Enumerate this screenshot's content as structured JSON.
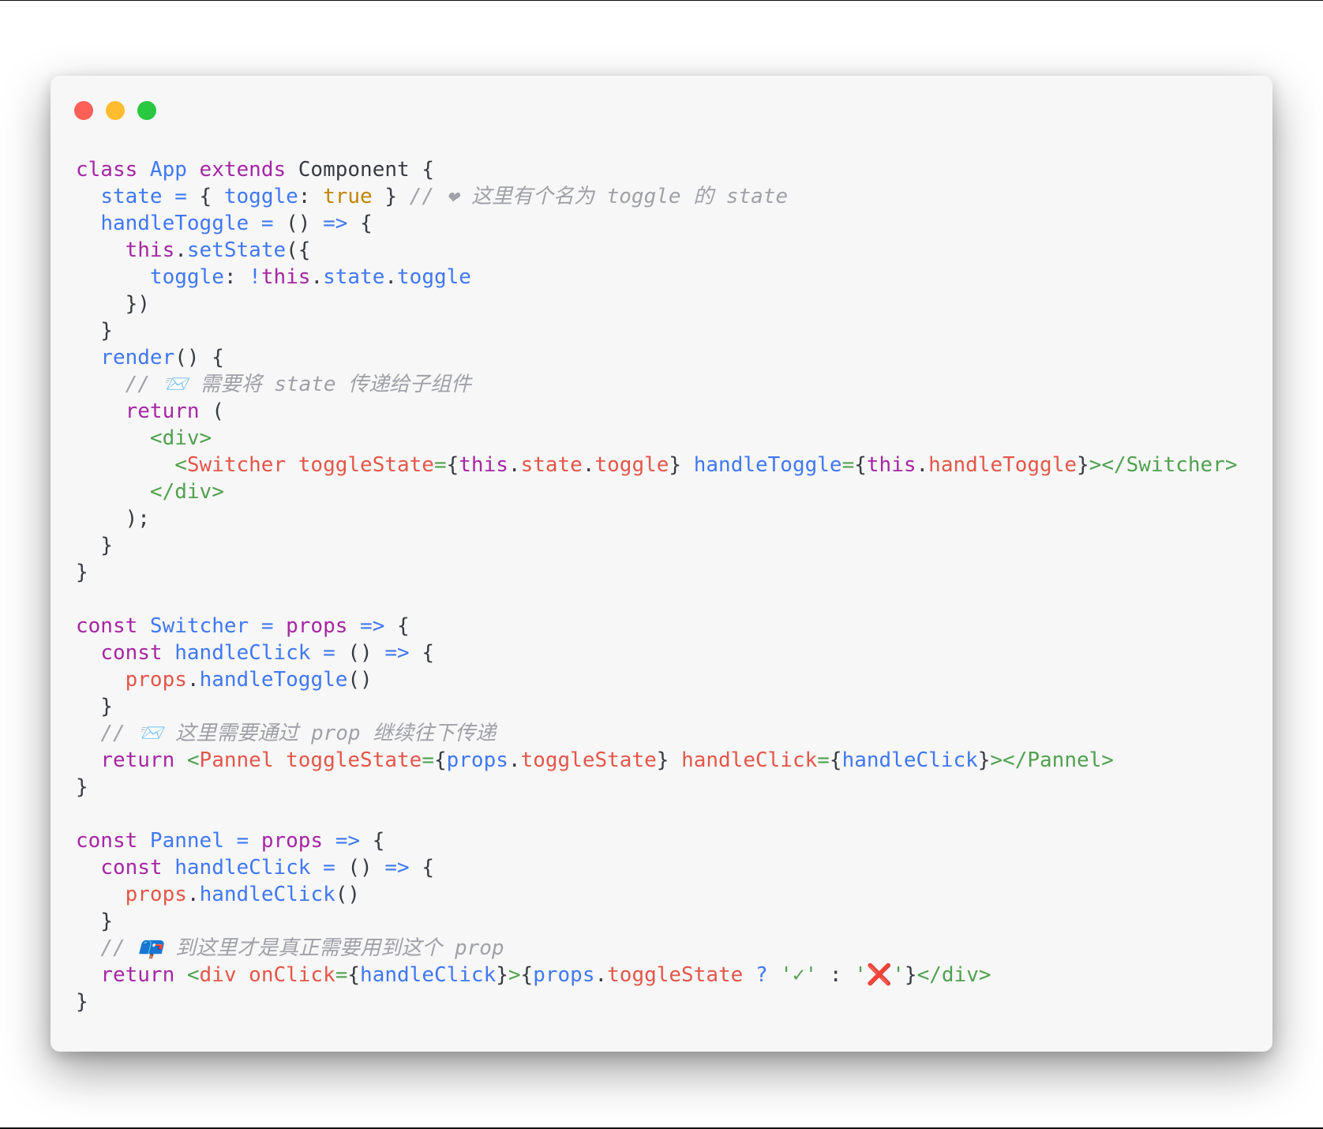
{
  "window": {
    "traffic_lights": [
      {
        "name": "close",
        "color": "#fe5f57"
      },
      {
        "name": "minimize",
        "color": "#febc2e"
      },
      {
        "name": "maximize",
        "color": "#28c840"
      }
    ]
  },
  "colors": {
    "keyword": "#a626a4",
    "function": "#4078f2",
    "boolean": "#c18401",
    "comment": "#a0a1a7",
    "tag": "#50a14f",
    "attribute": "#e45649",
    "punctuation": "#383a42"
  },
  "code": {
    "lines": [
      [
        [
          "k",
          "class "
        ],
        [
          "fn",
          "App "
        ],
        [
          "k",
          "extends "
        ],
        [
          "p",
          "Component {"
        ]
      ],
      [
        [
          "p",
          "  "
        ],
        [
          "fn",
          "state "
        ],
        [
          "fn",
          "= "
        ],
        [
          "p",
          "{ "
        ],
        [
          "fn",
          "toggle"
        ],
        [
          "p",
          ": "
        ],
        [
          "bool",
          "true "
        ],
        [
          "p",
          "} "
        ],
        [
          "c",
          "// ❤ 这里有个名为 toggle 的 state"
        ]
      ],
      [
        [
          "p",
          "  "
        ],
        [
          "fn",
          "handleToggle "
        ],
        [
          "fn",
          "= "
        ],
        [
          "p",
          "() "
        ],
        [
          "fn",
          "=> "
        ],
        [
          "p",
          "{"
        ]
      ],
      [
        [
          "p",
          "    "
        ],
        [
          "k",
          "this"
        ],
        [
          "p",
          "."
        ],
        [
          "fn",
          "setState"
        ],
        [
          "p",
          "({"
        ]
      ],
      [
        [
          "p",
          "      "
        ],
        [
          "fn",
          "toggle"
        ],
        [
          "p",
          ": "
        ],
        [
          "fn",
          "!"
        ],
        [
          "k",
          "this"
        ],
        [
          "p",
          "."
        ],
        [
          "fn",
          "state"
        ],
        [
          "p",
          "."
        ],
        [
          "fn",
          "toggle"
        ]
      ],
      [
        [
          "p",
          "    })"
        ]
      ],
      [
        [
          "p",
          "  }"
        ]
      ],
      [
        [
          "p",
          "  "
        ],
        [
          "fn",
          "render"
        ],
        [
          "p",
          "() {"
        ]
      ],
      [
        [
          "p",
          "    "
        ],
        [
          "c",
          "// 📨 需要将 state 传递给子组件"
        ]
      ],
      [
        [
          "p",
          "    "
        ],
        [
          "k",
          "return "
        ],
        [
          "p",
          "("
        ]
      ],
      [
        [
          "p",
          "      "
        ],
        [
          "tag",
          "<div>"
        ]
      ],
      [
        [
          "p",
          "        "
        ],
        [
          "tag",
          "<"
        ],
        [
          "attr",
          "Switcher toggleState"
        ],
        [
          "tag",
          "="
        ],
        [
          "p",
          "{"
        ],
        [
          "k",
          "this"
        ],
        [
          "p",
          "."
        ],
        [
          "attr",
          "state"
        ],
        [
          "p",
          "."
        ],
        [
          "attr",
          "toggle"
        ],
        [
          "p",
          "} "
        ],
        [
          "fn",
          "handleToggle"
        ],
        [
          "tag",
          "="
        ],
        [
          "p",
          "{"
        ],
        [
          "k",
          "this"
        ],
        [
          "p",
          "."
        ],
        [
          "attr",
          "handleToggle"
        ],
        [
          "p",
          "}"
        ],
        [
          "tag",
          "></Switcher>"
        ]
      ],
      [
        [
          "p",
          "      "
        ],
        [
          "tag",
          "</div>"
        ]
      ],
      [
        [
          "p",
          "    );"
        ]
      ],
      [
        [
          "p",
          "  }"
        ]
      ],
      [
        [
          "p",
          "}"
        ]
      ],
      [
        [
          "p",
          ""
        ]
      ],
      [
        [
          "k",
          "const "
        ],
        [
          "fn",
          "Switcher "
        ],
        [
          "fn",
          "= "
        ],
        [
          "k",
          "props "
        ],
        [
          "fn",
          "=> "
        ],
        [
          "p",
          "{"
        ]
      ],
      [
        [
          "p",
          "  "
        ],
        [
          "k",
          "const "
        ],
        [
          "fn",
          "handleClick "
        ],
        [
          "fn",
          "= "
        ],
        [
          "p",
          "() "
        ],
        [
          "fn",
          "=> "
        ],
        [
          "p",
          "{"
        ]
      ],
      [
        [
          "p",
          "    "
        ],
        [
          "attr",
          "props"
        ],
        [
          "p",
          "."
        ],
        [
          "fn",
          "handleToggle"
        ],
        [
          "p",
          "()"
        ]
      ],
      [
        [
          "p",
          "  }"
        ]
      ],
      [
        [
          "p",
          "  "
        ],
        [
          "c",
          "// 📨 这里需要通过 prop 继续往下传递"
        ]
      ],
      [
        [
          "p",
          "  "
        ],
        [
          "k",
          "return "
        ],
        [
          "tag",
          "<"
        ],
        [
          "attr",
          "Pannel toggleState"
        ],
        [
          "tag",
          "="
        ],
        [
          "p",
          "{"
        ],
        [
          "fn",
          "props"
        ],
        [
          "p",
          "."
        ],
        [
          "attr",
          "toggleState"
        ],
        [
          "p",
          "} "
        ],
        [
          "attr",
          "handleClick"
        ],
        [
          "tag",
          "="
        ],
        [
          "p",
          "{"
        ],
        [
          "fn",
          "handleClick"
        ],
        [
          "p",
          "}"
        ],
        [
          "tag",
          "></Pannel>"
        ]
      ],
      [
        [
          "p",
          "}"
        ]
      ],
      [
        [
          "p",
          ""
        ]
      ],
      [
        [
          "k",
          "const "
        ],
        [
          "fn",
          "Pannel "
        ],
        [
          "fn",
          "= "
        ],
        [
          "k",
          "props "
        ],
        [
          "fn",
          "=> "
        ],
        [
          "p",
          "{"
        ]
      ],
      [
        [
          "p",
          "  "
        ],
        [
          "k",
          "const "
        ],
        [
          "fn",
          "handleClick "
        ],
        [
          "fn",
          "= "
        ],
        [
          "p",
          "() "
        ],
        [
          "fn",
          "=> "
        ],
        [
          "p",
          "{"
        ]
      ],
      [
        [
          "p",
          "    "
        ],
        [
          "attr",
          "props"
        ],
        [
          "p",
          "."
        ],
        [
          "fn",
          "handleClick"
        ],
        [
          "p",
          "()"
        ]
      ],
      [
        [
          "p",
          "  }"
        ]
      ],
      [
        [
          "p",
          "  "
        ],
        [
          "c",
          "// 📪 到这里才是真正需要用到这个 prop"
        ]
      ],
      [
        [
          "p",
          "  "
        ],
        [
          "k",
          "return "
        ],
        [
          "tag",
          "<"
        ],
        [
          "attr",
          "div onClick"
        ],
        [
          "tag",
          "="
        ],
        [
          "p",
          "{"
        ],
        [
          "fn",
          "handleClick"
        ],
        [
          "p",
          "}"
        ],
        [
          "tag",
          ">"
        ],
        [
          "p",
          "{"
        ],
        [
          "fn",
          "props"
        ],
        [
          "p",
          "."
        ],
        [
          "attr",
          "toggleState "
        ],
        [
          "fn",
          "? "
        ],
        [
          "tag",
          "'"
        ],
        [
          "ok",
          "✓"
        ],
        [
          "tag",
          "' "
        ],
        [
          "p",
          ": "
        ],
        [
          "tag",
          "'"
        ],
        [
          "bad",
          "❌"
        ],
        [
          "tag",
          "'"
        ],
        [
          "p",
          "}"
        ],
        [
          "tag",
          "</div>"
        ]
      ],
      [
        [
          "p",
          "}"
        ]
      ]
    ]
  }
}
